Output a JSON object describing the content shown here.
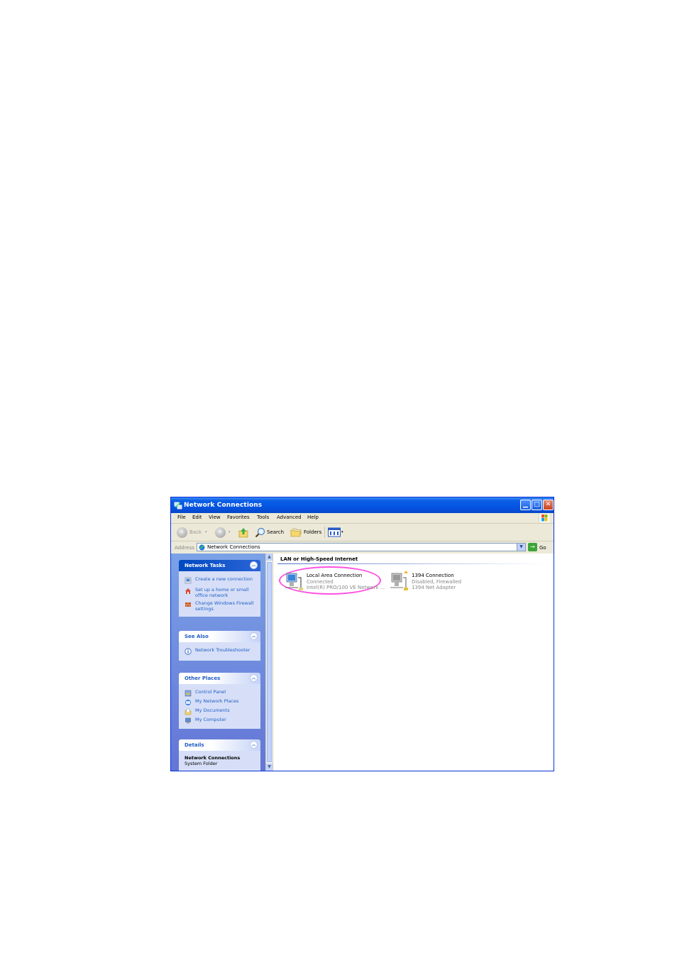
{
  "window": {
    "title": "Network Connections"
  },
  "menu": [
    "File",
    "Edit",
    "View",
    "Favorites",
    "Tools",
    "Advanced",
    "Help"
  ],
  "toolbar": {
    "back": "Back",
    "search": "Search",
    "folders": "Folders"
  },
  "address": {
    "label": "Address",
    "value": "Network Connections",
    "go": "Go"
  },
  "panels": {
    "network_tasks": {
      "title": "Network Tasks",
      "items": [
        "Create a new connection",
        "Set up a home or small office network",
        "Change Windows Firewall settings"
      ]
    },
    "see_also": {
      "title": "See Also",
      "items": [
        "Network Troubleshooter"
      ]
    },
    "other_places": {
      "title": "Other Places",
      "items": [
        "Control Panel",
        "My Network Places",
        "My Documents",
        "My Computer"
      ]
    },
    "details": {
      "title": "Details",
      "name": "Network Connections",
      "type": "System Folder"
    }
  },
  "content": {
    "group": "LAN or High-Speed Internet",
    "connections": [
      {
        "name": "Local Area Connection",
        "status": "Connected",
        "device": "Intel(R) PRO/100 VE Network ..."
      },
      {
        "name": "1394 Connection",
        "status": "Disabled, Firewalled",
        "device": "1394 Net Adapter"
      }
    ]
  },
  "colors": {
    "title_bar": "#0554e3",
    "task_pane": "#6375d6",
    "highlight": "#ff4fe1"
  }
}
